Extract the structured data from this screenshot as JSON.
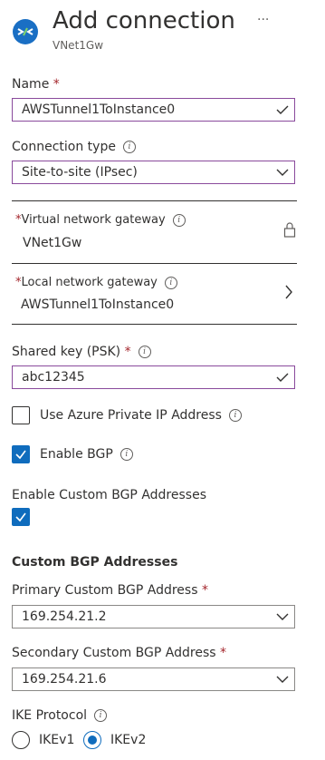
{
  "header": {
    "title": "Add connection",
    "subtitle": "VNet1Gw",
    "more": "···"
  },
  "name": {
    "label": "Name",
    "required": "*",
    "value": "AWSTunnel1ToInstance0"
  },
  "connection_type": {
    "label": "Connection type",
    "value": "Site-to-site (IPsec)"
  },
  "virtual_network_gateway": {
    "required": "*",
    "label": "Virtual network gateway",
    "value": "VNet1Gw"
  },
  "local_network_gateway": {
    "required": "*",
    "label": "Local network gateway",
    "value": "AWSTunnel1ToInstance0"
  },
  "shared_key": {
    "label": "Shared key (PSK)",
    "required": "*",
    "value": "abc12345"
  },
  "use_private_ip": {
    "label": "Use Azure Private IP Address",
    "checked": false
  },
  "enable_bgp": {
    "label": "Enable BGP",
    "checked": true
  },
  "enable_custom_bgp": {
    "label": "Enable Custom BGP Addresses",
    "checked": true
  },
  "custom_bgp": {
    "heading": "Custom BGP Addresses",
    "primary_label": "Primary Custom BGP Address",
    "primary_required": "*",
    "primary_value": "169.254.21.2",
    "secondary_label": "Secondary Custom BGP Address",
    "secondary_required": "*",
    "secondary_value": "169.254.21.6"
  },
  "ike": {
    "label": "IKE Protocol",
    "options": [
      "IKEv1",
      "IKEv2"
    ],
    "selected": "IKEv2"
  },
  "colors": {
    "accent": "#0f6cbd",
    "required": "#a4262c",
    "valid_border": "#8a4a9c",
    "text": "#323130"
  }
}
